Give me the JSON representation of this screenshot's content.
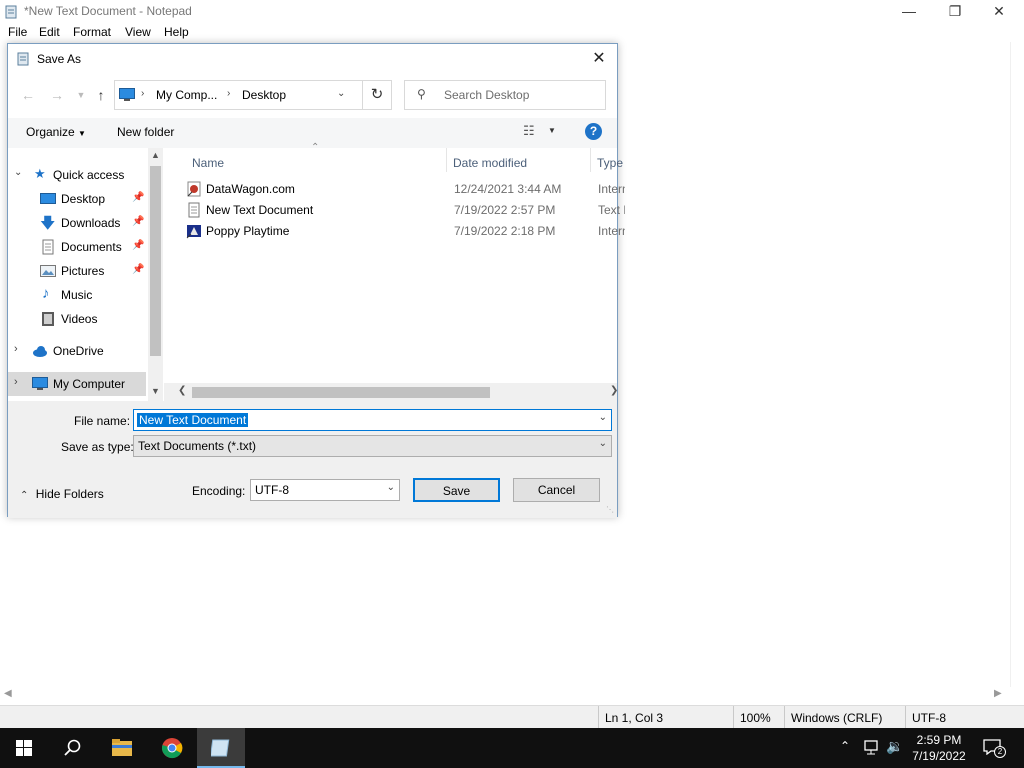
{
  "notepad": {
    "title": "*New Text Document - Notepad",
    "menu": [
      "File",
      "Edit",
      "Format",
      "View",
      "Help"
    ],
    "status": {
      "position": "Ln 1, Col 3",
      "zoom": "100%",
      "line_ending": "Windows (CRLF)",
      "encoding": "UTF-8"
    }
  },
  "dialog": {
    "title": "Save As",
    "address": {
      "root": "My Comp...",
      "current": "Desktop"
    },
    "search_placeholder": "Search Desktop",
    "toolbar": {
      "organize": "Organize",
      "new_folder": "New folder"
    },
    "tree": {
      "quick_access": "Quick access",
      "items": [
        {
          "label": "Desktop",
          "icon": "desktop-icon",
          "pinned": true
        },
        {
          "label": "Downloads",
          "icon": "download-icon",
          "pinned": true
        },
        {
          "label": "Documents",
          "icon": "documents-icon",
          "pinned": true
        },
        {
          "label": "Pictures",
          "icon": "pictures-icon",
          "pinned": true
        },
        {
          "label": "Music",
          "icon": "music-icon",
          "pinned": false
        },
        {
          "label": "Videos",
          "icon": "videos-icon",
          "pinned": false
        }
      ],
      "onedrive": "OneDrive",
      "my_computer": "My Computer"
    },
    "columns": {
      "name": "Name",
      "date": "Date modified",
      "type": "Type"
    },
    "files": [
      {
        "name": "DataWagon.com",
        "date": "12/24/2021 3:44 AM",
        "type": "Intern",
        "icon": "internet-shortcut-icon"
      },
      {
        "name": "New Text Document",
        "date": "7/19/2022 2:57 PM",
        "type": "Text D",
        "icon": "text-file-icon"
      },
      {
        "name": "Poppy Playtime",
        "date": "7/19/2022 2:18 PM",
        "type": "Intern",
        "icon": "game-shortcut-icon"
      }
    ],
    "file_name_label": "File name:",
    "file_name_value": "New Text Document",
    "save_type_label": "Save as type:",
    "save_type_value": "Text Documents (*.txt)",
    "hide_folders": "Hide Folders",
    "encoding_label": "Encoding:",
    "encoding_value": "UTF-8",
    "save": "Save",
    "cancel": "Cancel"
  },
  "taskbar": {
    "time": "2:59 PM",
    "date": "7/19/2022",
    "notification_count": "2"
  },
  "colors": {
    "accent": "#0078d7",
    "selection": "#0078d7",
    "taskbar": "#101010"
  }
}
